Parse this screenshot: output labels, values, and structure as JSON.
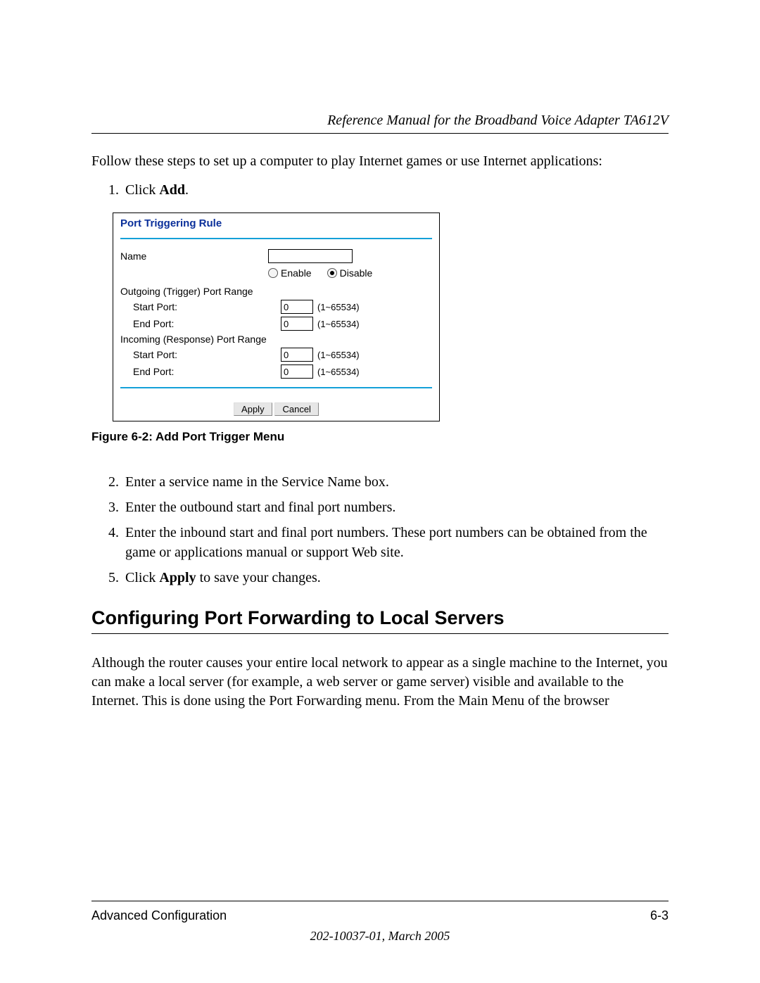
{
  "header": {
    "title": "Reference Manual for the Broadband Voice Adapter TA612V"
  },
  "intro": "Follow these steps to set up a computer to play Internet games or use Internet applications:",
  "step1_pre": "Click ",
  "step1_bold": "Add",
  "step1_post": ".",
  "ui": {
    "title": "Port Triggering Rule",
    "name_label": "Name",
    "name_value": "",
    "enable_label": "Enable",
    "disable_label": "Disable",
    "enabled_selected": "disable",
    "outgoing_label": "Outgoing (Trigger) Port Range",
    "incoming_label": "Incoming (Response) Port Range",
    "start_port_label": "Start Port:",
    "end_port_label": "End Port:",
    "port_hint": "(1~65534)",
    "out_start": "0",
    "out_end": "0",
    "in_start": "0",
    "in_end": "0",
    "apply_label": "Apply",
    "cancel_label": "Cancel"
  },
  "figure_caption": "Figure 6-2:  Add Port Trigger Menu",
  "steps": {
    "s2": "Enter a service name in the Service Name box.",
    "s3": "Enter the outbound start and final port numbers.",
    "s4": "Enter the inbound start and final port numbers. These port numbers can be obtained from the game or applications manual or support Web site.",
    "s5_pre": "Click ",
    "s5_bold": "Apply",
    "s5_post": " to save your changes."
  },
  "section_heading": "Configuring Port Forwarding to Local Servers",
  "section_body": "Although the router causes your entire local network to appear as a single machine to the Internet, you can make a local server (for example, a web server or game server) visible and available to the Internet. This is done using the Port Forwarding menu. From the Main Menu of the browser",
  "footer": {
    "left": "Advanced Configuration",
    "right": "6-3",
    "pub": "202-10037-01, March 2005"
  }
}
